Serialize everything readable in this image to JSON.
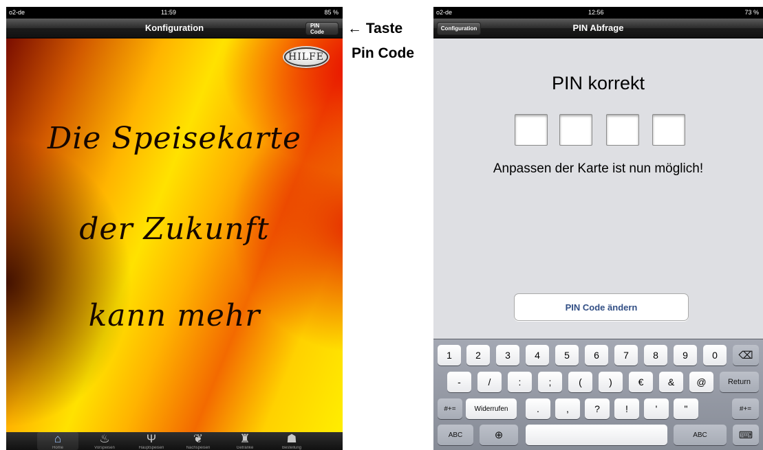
{
  "left": {
    "status": {
      "carrier": "o2-de",
      "time": "11:59",
      "battery": "85 %"
    },
    "navbar": {
      "title": "Konfiguration",
      "pin_button": "PIN Code"
    },
    "hilfe_button": "HILFE",
    "slogan": [
      "Die Speisekarte",
      "der Zukunft",
      "kann mehr"
    ],
    "tabs": [
      {
        "label": "Home",
        "icon": "home-icon",
        "glyph": "⌂"
      },
      {
        "label": "Vorspeisen",
        "icon": "soup-icon",
        "glyph": "♨"
      },
      {
        "label": "Hauptspeisen",
        "icon": "fork-knife-icon",
        "glyph": "Ψ"
      },
      {
        "label": "Nachspeisen",
        "icon": "dessert-icon",
        "glyph": "❦"
      },
      {
        "label": "Getränke",
        "icon": "bottles-icon",
        "glyph": "♜"
      },
      {
        "label": "Bestellung",
        "icon": "waiter-icon",
        "glyph": "☗"
      }
    ]
  },
  "annotation": {
    "line1": "Taste",
    "line2": "Pin Code",
    "arrow": "←"
  },
  "right": {
    "status": {
      "carrier": "o2-de",
      "time": "12:56",
      "battery": "73 %"
    },
    "navbar": {
      "title": "PIN Abfrage",
      "back_button": "Configuration"
    },
    "pin_title": "PIN korrekt",
    "pin_message": "Anpassen der Karte ist nun möglich!",
    "change_button": "PIN Code ändern",
    "keyboard": {
      "row1": [
        "1",
        "2",
        "3",
        "4",
        "5",
        "6",
        "7",
        "8",
        "9",
        "0"
      ],
      "row1_delete": "⌫",
      "row2": [
        "-",
        "/",
        ":",
        ";",
        "(",
        ")",
        "€",
        "&",
        "@"
      ],
      "row2_return": "Return",
      "row3_left": "#+=",
      "row3_undo": "Widerrufen",
      "row3": [
        ".",
        ",",
        "?",
        "!",
        "'",
        "\""
      ],
      "row3_right": "#+=",
      "row4_abc": "ABC",
      "row4_globe": "⊕",
      "row4_abc_right": "ABC",
      "row4_hide": "⌨"
    }
  }
}
